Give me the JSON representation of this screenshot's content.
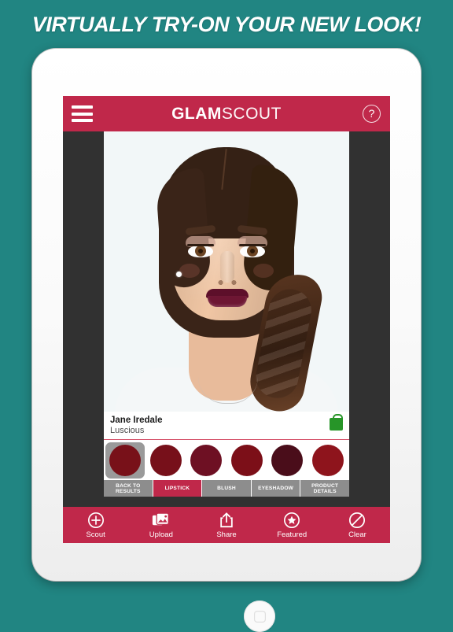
{
  "promo": {
    "headline": "VIRTUALLY TRY-ON YOUR NEW LOOK!"
  },
  "colors": {
    "background_teal": "#218582",
    "brand_red": "#c0284a",
    "stage_gray": "#313131",
    "tab_gray": "#8d8d8d",
    "bag_green": "#279528",
    "swatch_selected_bg": "#9a9a9a"
  },
  "app": {
    "header": {
      "menu_icon": "hamburger-icon",
      "brand_bold": "GLAM",
      "brand_light": "SCOUT",
      "help_icon": "question-mark-icon",
      "help_label": "?"
    },
    "product": {
      "brand": "Jane Iredale",
      "shade": "Luscious",
      "buy_icon": "shopping-bag-icon"
    },
    "swatches": [
      {
        "color": "#781119",
        "selected": true
      },
      {
        "color": "#77101a",
        "selected": false
      },
      {
        "color": "#6e1023",
        "selected": false
      },
      {
        "color": "#7c0f18",
        "selected": false
      },
      {
        "color": "#4a0d1a",
        "selected": false
      },
      {
        "color": "#8e141c",
        "selected": false
      }
    ],
    "tabs": [
      {
        "label": "BACK TO RESULTS",
        "active": false
      },
      {
        "label": "LIPSTICK",
        "active": true
      },
      {
        "label": "BLUSH",
        "active": false
      },
      {
        "label": "EYESHADOW",
        "active": false
      },
      {
        "label": "PRODUCT DETAILS",
        "active": false
      }
    ],
    "toolbar": [
      {
        "label": "Scout",
        "icon": "plus-circle-icon"
      },
      {
        "label": "Upload",
        "icon": "photos-icon"
      },
      {
        "label": "Share",
        "icon": "share-box-icon"
      },
      {
        "label": "Featured",
        "icon": "star-circle-icon"
      },
      {
        "label": "Clear",
        "icon": "prohibition-icon"
      }
    ]
  },
  "device": {
    "camera_icon": "front-camera-icon",
    "sensor_icon": "ambient-sensor-icon",
    "home_button_icon": "home-button-icon"
  }
}
